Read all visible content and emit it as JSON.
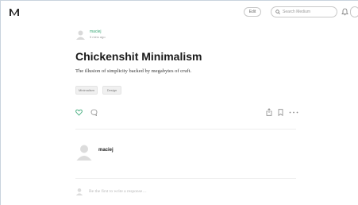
{
  "header": {
    "edit_label": "Edit",
    "search_placeholder": "Search Medium"
  },
  "author": {
    "name": "maciej",
    "time": "5 mins ago"
  },
  "post": {
    "title": "Chickenshit Minimalism",
    "subtitle": "The illusion of simplicity backed by megabytes of cruft.",
    "tags": [
      "Minimalism",
      "Design"
    ]
  },
  "footer_author": {
    "name": "maciej"
  },
  "response": {
    "placeholder": "Be the first to write a response…"
  },
  "colors": {
    "accent": "#3aa876",
    "icon": "#8a8a8a"
  }
}
